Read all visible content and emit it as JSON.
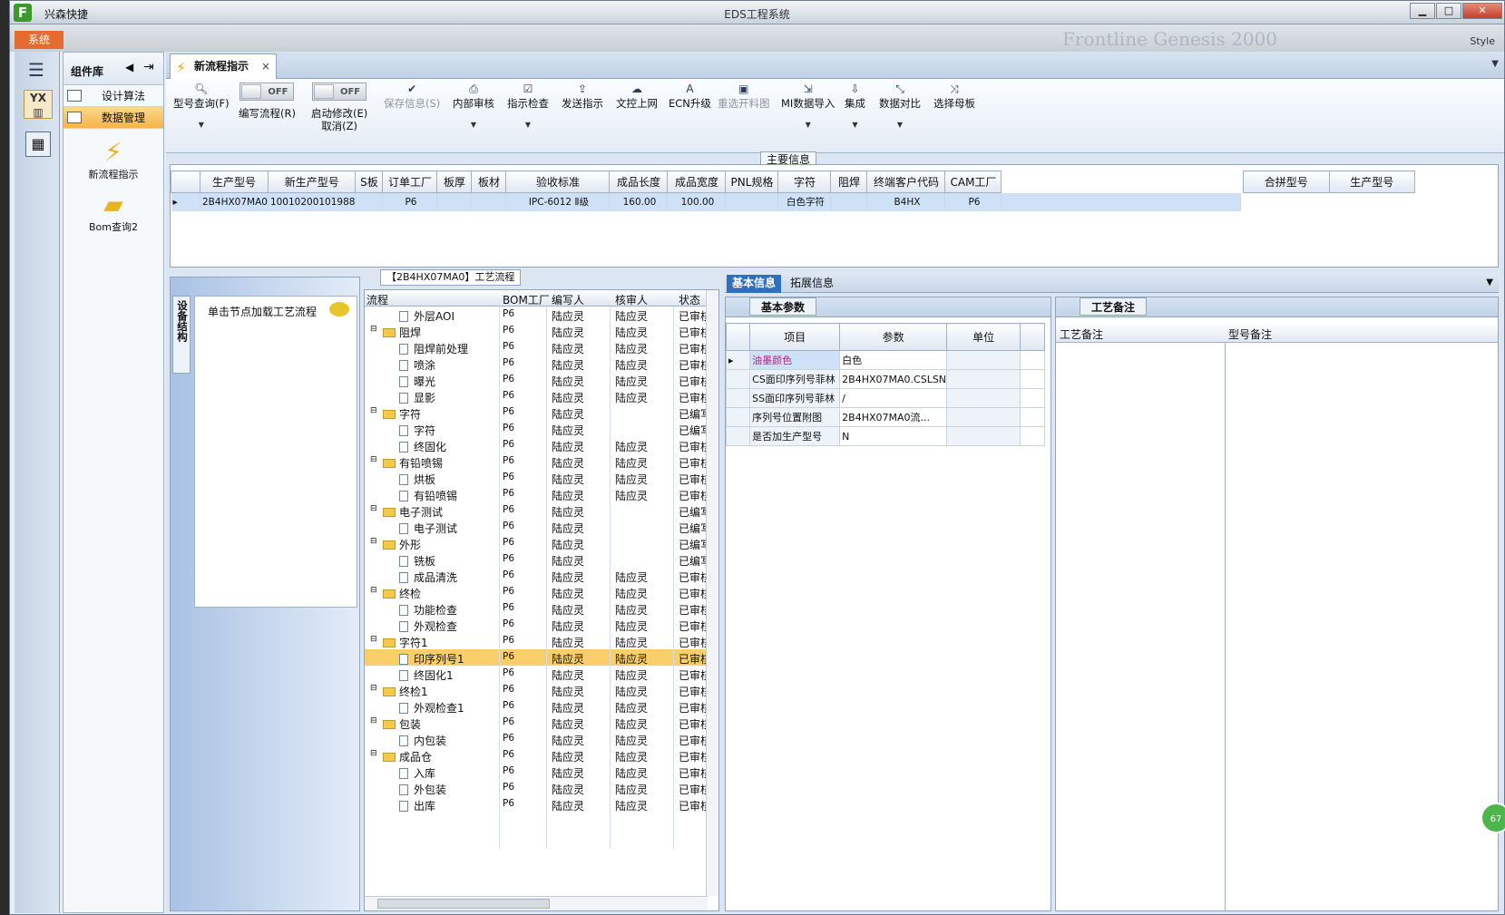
{
  "app": {
    "name": "兴森快捷",
    "window_title": "EDS工程系统",
    "sys_button": "系统",
    "style_label": "Style",
    "brand_text": "Frontline  Genesis 2000"
  },
  "window_buttons": [
    "▁",
    "□",
    "✕"
  ],
  "components": {
    "title": "组件库",
    "items": [
      {
        "label": "设计算法"
      },
      {
        "label": "数据管理"
      }
    ],
    "tools": [
      {
        "label": "新流程指示",
        "icon": "⚡"
      },
      {
        "label": "Bom查询2",
        "icon": "📂"
      }
    ]
  },
  "tab": {
    "label": "新流程指示",
    "close": "×"
  },
  "ribbon": {
    "query": "型号查询(F)",
    "edit_flow": "编写流程(R)",
    "start_modify": "启动修改(E)",
    "cancel": "取消(Z)",
    "toggle_off": "OFF",
    "save": "保存信息(S)",
    "internal_review": "内部审核",
    "indication_check": "指示检查",
    "send": "发送指示",
    "doc_upload": "文控上网",
    "ecn": "ECN升级",
    "reselect": "重选开料图",
    "mi_import": "MI数据导入",
    "integrate": "集成",
    "compare": "数据对比",
    "select_master": "选择母板"
  },
  "main_info": {
    "label": "主要信息",
    "columns": [
      "生产型号",
      "新生产型号",
      "S板",
      "订单工厂",
      "板厚",
      "板材",
      "验收标准",
      "成品长度",
      "成品宽度",
      "PNL规格",
      "字符",
      "阻焊",
      "终端客户代码",
      "CAM工厂"
    ],
    "row": [
      "2B4HX07MA0",
      "10010200101988",
      "",
      "P6",
      "",
      "",
      "IPC-6012 Ⅱ级",
      "160.00",
      "100.00",
      "",
      "白色字符",
      "",
      "B4HX",
      "P6"
    ],
    "side_columns": [
      "合拼型号",
      "生产型号"
    ]
  },
  "struct": {
    "vtab": "设备结构",
    "hint": "单击节点加载工艺流程"
  },
  "flow": {
    "label": "【2B4HX07MA0】工艺流程",
    "columns": [
      "流程",
      "BOM工厂",
      "编写人",
      "核审人",
      "状态"
    ],
    "rows": [
      {
        "n": "外层AOI",
        "lvl": 1,
        "f": "P6",
        "w": "陆应灵",
        "r": "陆应灵",
        "s": "已审核"
      },
      {
        "n": "阻焊",
        "lvl": 0,
        "f": "P6",
        "w": "陆应灵",
        "r": "陆应灵",
        "s": "已审核"
      },
      {
        "n": "阻焊前处理",
        "lvl": 1,
        "f": "P6",
        "w": "陆应灵",
        "r": "陆应灵",
        "s": "已审核"
      },
      {
        "n": "喷涂",
        "lvl": 1,
        "f": "P6",
        "w": "陆应灵",
        "r": "陆应灵",
        "s": "已审核"
      },
      {
        "n": "曝光",
        "lvl": 1,
        "f": "P6",
        "w": "陆应灵",
        "r": "陆应灵",
        "s": "已审核"
      },
      {
        "n": "显影",
        "lvl": 1,
        "f": "P6",
        "w": "陆应灵",
        "r": "陆应灵",
        "s": "已审核"
      },
      {
        "n": "字符",
        "lvl": 0,
        "f": "P6",
        "w": "陆应灵",
        "r": "",
        "s": "已编写"
      },
      {
        "n": "字符",
        "lvl": 1,
        "f": "P6",
        "w": "陆应灵",
        "r": "",
        "s": "已编写"
      },
      {
        "n": "终固化",
        "lvl": 1,
        "f": "P6",
        "w": "陆应灵",
        "r": "陆应灵",
        "s": "已审核"
      },
      {
        "n": "有铅喷锡",
        "lvl": 0,
        "f": "P6",
        "w": "陆应灵",
        "r": "陆应灵",
        "s": "已审核"
      },
      {
        "n": "烘板",
        "lvl": 1,
        "f": "P6",
        "w": "陆应灵",
        "r": "陆应灵",
        "s": "已审核"
      },
      {
        "n": "有铅喷锡",
        "lvl": 1,
        "f": "P6",
        "w": "陆应灵",
        "r": "陆应灵",
        "s": "已审核"
      },
      {
        "n": "电子测试",
        "lvl": 0,
        "f": "P6",
        "w": "陆应灵",
        "r": "",
        "s": "已编写"
      },
      {
        "n": "电子测试",
        "lvl": 1,
        "f": "P6",
        "w": "陆应灵",
        "r": "",
        "s": "已编写"
      },
      {
        "n": "外形",
        "lvl": 0,
        "f": "P6",
        "w": "陆应灵",
        "r": "",
        "s": "已编写"
      },
      {
        "n": "铣板",
        "lvl": 1,
        "f": "P6",
        "w": "陆应灵",
        "r": "",
        "s": "已编写"
      },
      {
        "n": "成品清洗",
        "lvl": 1,
        "f": "P6",
        "w": "陆应灵",
        "r": "陆应灵",
        "s": "已审核"
      },
      {
        "n": "终检",
        "lvl": 0,
        "f": "P6",
        "w": "陆应灵",
        "r": "陆应灵",
        "s": "已审核"
      },
      {
        "n": "功能检查",
        "lvl": 1,
        "f": "P6",
        "w": "陆应灵",
        "r": "陆应灵",
        "s": "已审核"
      },
      {
        "n": "外观检查",
        "lvl": 1,
        "f": "P6",
        "w": "陆应灵",
        "r": "陆应灵",
        "s": "已审核"
      },
      {
        "n": "字符1",
        "lvl": 0,
        "f": "P6",
        "w": "陆应灵",
        "r": "陆应灵",
        "s": "已审核"
      },
      {
        "n": "印序列号1",
        "lvl": 1,
        "f": "P6",
        "w": "陆应灵",
        "r": "陆应灵",
        "s": "已审核",
        "sel": true
      },
      {
        "n": "终固化1",
        "lvl": 1,
        "f": "P6",
        "w": "陆应灵",
        "r": "陆应灵",
        "s": "已审核"
      },
      {
        "n": "终检1",
        "lvl": 0,
        "f": "P6",
        "w": "陆应灵",
        "r": "陆应灵",
        "s": "已审核"
      },
      {
        "n": "外观检查1",
        "lvl": 1,
        "f": "P6",
        "w": "陆应灵",
        "r": "陆应灵",
        "s": "已审核"
      },
      {
        "n": "包装",
        "lvl": 0,
        "f": "P6",
        "w": "陆应灵",
        "r": "陆应灵",
        "s": "已审核"
      },
      {
        "n": "内包装",
        "lvl": 1,
        "f": "P6",
        "w": "陆应灵",
        "r": "陆应灵",
        "s": "已审核"
      },
      {
        "n": "成品仓",
        "lvl": 0,
        "f": "P6",
        "w": "陆应灵",
        "r": "陆应灵",
        "s": "已审核"
      },
      {
        "n": "入库",
        "lvl": 1,
        "f": "P6",
        "w": "陆应灵",
        "r": "陆应灵",
        "s": "已审核"
      },
      {
        "n": "外包装",
        "lvl": 1,
        "f": "P6",
        "w": "陆应灵",
        "r": "陆应灵",
        "s": "已审核"
      },
      {
        "n": "出库",
        "lvl": 1,
        "f": "P6",
        "w": "陆应灵",
        "r": "陆应灵",
        "s": "已审核"
      }
    ]
  },
  "info_tabs": [
    "基本信息",
    "拓展信息"
  ],
  "basic": {
    "title": "基本参数",
    "columns": [
      "项目",
      "参数",
      "单位"
    ],
    "rows": [
      {
        "item": "油墨颜色",
        "param": "白色",
        "unit": ""
      },
      {
        "item": "CS面印序列号菲林",
        "param": "2B4HX07MA0.CSLSN",
        "unit": ""
      },
      {
        "item": "SS面印序列号菲林",
        "param": "/",
        "unit": ""
      },
      {
        "item": "序列号位置附图",
        "param": "2B4HX07MA0流...",
        "unit": ""
      },
      {
        "item": "是否加生产型号",
        "param": "N",
        "unit": ""
      }
    ]
  },
  "process": {
    "title": "工艺备注",
    "col1": "工艺备注",
    "col2": "型号备注"
  },
  "badge": "67"
}
